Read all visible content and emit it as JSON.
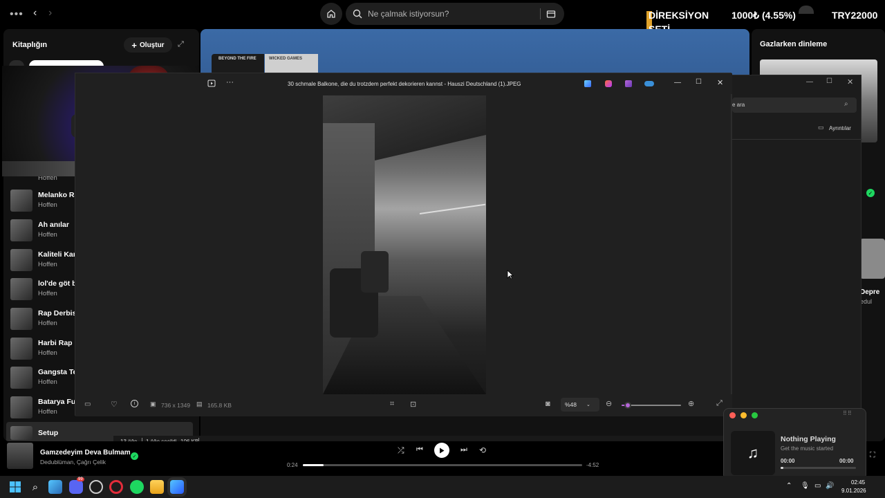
{
  "spotify": {
    "search_placeholder": "Ne çalmak istiyorsun?",
    "ticker_left": "DİREKSİYON",
    "ticker_left2": "SETİ",
    "ticker_middle": "1000₺ (4.55%)",
    "ticker_right": "TRY22000",
    "right_pane_title": "Gazlarken dinleme",
    "right_pane_card_label": "Depre",
    "right_pane_card_sub": "edul",
    "album1_label": "BEYOND THE FIRE",
    "album2_label": "WICKED GAMES"
  },
  "library": {
    "title": "Kitaplığın",
    "create_label": "Oluştur",
    "items": [
      {
        "name": "",
        "artist": "Hoffen"
      },
      {
        "name": "Melanko Ra",
        "artist": "Hoffen"
      },
      {
        "name": "Ah anılar",
        "artist": "Hoffen"
      },
      {
        "name": "Kaliteli Karc",
        "artist": "Hoffen"
      },
      {
        "name": "lol'de göt b",
        "artist": "Hoffen"
      },
      {
        "name": "Rap Derbisi",
        "artist": "Hoffen"
      },
      {
        "name": "Harbi Rap",
        "artist": "Hoffen"
      },
      {
        "name": "Gangsta Te",
        "artist": "Hoffen"
      },
      {
        "name": "Batarya Ful",
        "artist": "Hoffen"
      },
      {
        "name": "Setup",
        "artist": ""
      }
    ]
  },
  "photos": {
    "title": "30 schmale Balkone, die du trotzdem perfekt dekorieren kannst - Hauszi Deutschland (1).JPEG",
    "dimensions": "736 x 1349",
    "file_size": "165.8 KB",
    "zoom": "%48",
    "zoom_level": 0.1
  },
  "explorer": {
    "search_placeholder": "e ara",
    "details_label": "Ayrıntılar",
    "status_items": "13 öğe",
    "status_selected": "1 öğe seçildi",
    "status_size": "106 KB"
  },
  "player": {
    "track": "Gamzedeyim Deva Bulmam",
    "artists": "Dedublüman, Çağrı Çelik",
    "elapsed": "0:24",
    "remaining": "-4:52",
    "progress": 0.075
  },
  "widget": {
    "title": "Nothing Playing",
    "subtitle": "Get the music started",
    "time_left": "00:00",
    "time_right": "00:00",
    "progress": 0.04
  },
  "taskbar": {
    "time": "02:45",
    "date": "9.01.2026",
    "discord_badge": "99"
  },
  "colors": {
    "spotify_green": "#1ed760",
    "accent_purple": "#b565d8",
    "close_red": "#ff5f57",
    "minimize_yellow": "#febc2e",
    "maximize_green": "#28c840"
  }
}
